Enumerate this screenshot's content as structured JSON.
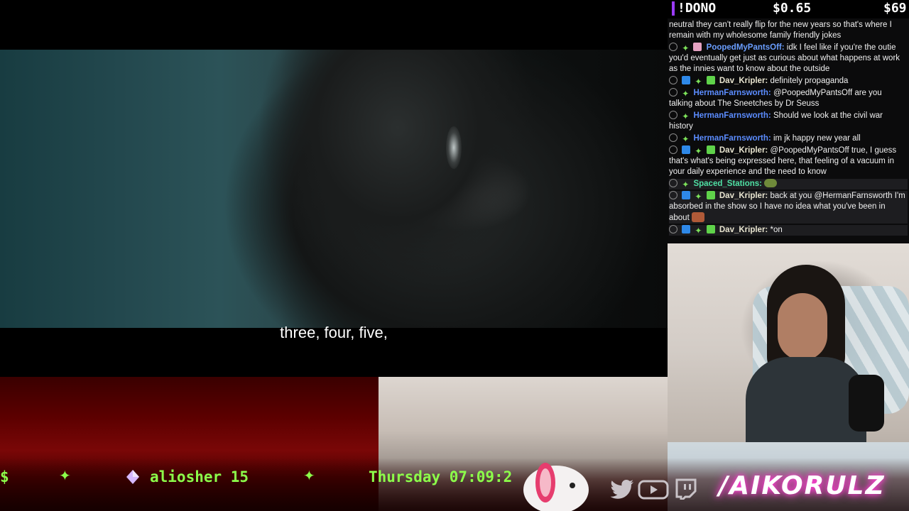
{
  "video": {
    "subtitle": "three, four, five,"
  },
  "chat": {
    "dono_label": "!DONO",
    "dono_amount": "$0.65",
    "dono_total": "$69",
    "messages": [
      {
        "user": "",
        "text": "neutral they can't really flip for the new years so that's where I remain with my wholesome family friendly jokes"
      },
      {
        "user": "PoopedMyPantsOff:",
        "text": "idk I feel like if you're the outie you'd eventually get just as curious about what happens at work as the innies want to know about the outside"
      },
      {
        "user": "Dav_Kripler:",
        "text": "definitely propaganda"
      },
      {
        "user": "HermanFarnsworth:",
        "text": "@PoopedMyPantsOff are you talking about The Sneetches by Dr Seuss"
      },
      {
        "user": "HermanFarnsworth:",
        "text": "Should we look at the civil war history"
      },
      {
        "user": "HermanFarnsworth:",
        "text": "im jk happy new year all"
      },
      {
        "user": "Dav_Kripler:",
        "text": "@PoopedMyPantsOff true, I guess that's what's being expressed here, that feeling of a vacuum in your daily experience and the need to know"
      },
      {
        "user": "Spaced_Stations:",
        "text": ""
      },
      {
        "user": "Dav_Kripler:",
        "text": "back at you @HermanFarnsworth I'm absorbed in the show so I have no idea what you've been in about"
      },
      {
        "user": "Dav_Kripler:",
        "text": "*on"
      }
    ]
  },
  "overlay": {
    "ticker_left": "$",
    "ticker_user": "aliosher 15",
    "ticker_clock": "Thursday 07:09:2",
    "channel": "/AIKORULZ"
  },
  "icons": {
    "star": "sparkle-icon",
    "gem": "gem-icon",
    "twitter": "twitter-icon",
    "youtube": "youtube-icon",
    "twitch": "twitch-icon"
  },
  "colors": {
    "ticker_green": "#8cff4a",
    "dono_purple": "#9b3bff",
    "channel_glow": "#ff3fd2"
  }
}
